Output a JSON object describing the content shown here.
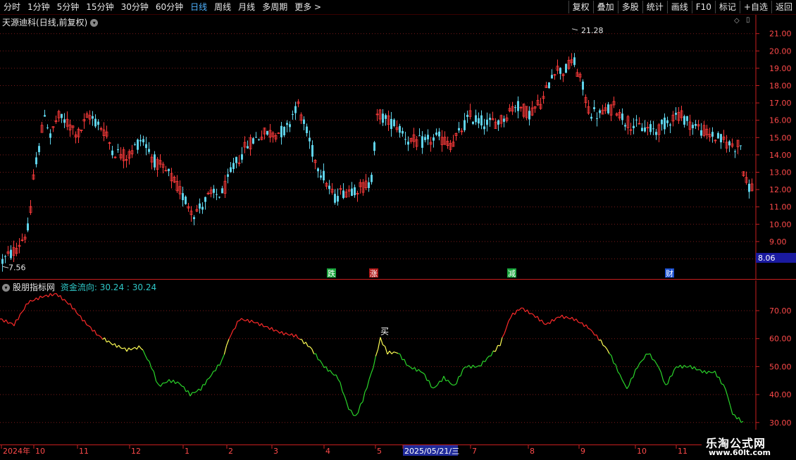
{
  "toolbar": {
    "periods": [
      "分时",
      "1分钟",
      "5分钟",
      "15分钟",
      "30分钟",
      "60分钟",
      "日线",
      "周线",
      "月线",
      "多周期",
      "更多 >"
    ],
    "active_period": "日线",
    "right_buttons": [
      "复权",
      "叠加",
      "多股",
      "统计",
      "画线",
      "F10",
      "标记",
      "+自选",
      "返回"
    ]
  },
  "main_chart": {
    "stock_name": "天源迪科",
    "mode": "(日线,前复权)",
    "price_labels": [
      "21.00",
      "20.00",
      "19.00",
      "18.00",
      "17.00",
      "16.00",
      "15.00",
      "14.00",
      "13.00",
      "12.00",
      "11.00",
      "10.00",
      "9.00",
      "8.00"
    ],
    "price_ticks": [
      21,
      20,
      19,
      18,
      17,
      16,
      15,
      14,
      13,
      12,
      11,
      10,
      9,
      8
    ],
    "high_label": "21.28",
    "low_label": "7.56",
    "current_price": "8.06",
    "markers": [
      {
        "text": "跌",
        "color": "#17a33a"
      },
      {
        "text": "涨",
        "color": "#b01818"
      },
      {
        "text": "减",
        "color": "#17a33a"
      },
      {
        "text": "财",
        "color": "#1a4fd0"
      }
    ],
    "colors": {
      "up": "#ff3b3b",
      "down": "#5fd3ea",
      "grid": "#7a1a1a",
      "axis": "#c81e1e"
    }
  },
  "indicator": {
    "name": "股朋指标网",
    "series_label": "资金流向:",
    "value1": "30.24",
    "value2": "30.24",
    "levels": [
      "70.00",
      "60.00",
      "50.00",
      "40.00",
      "30.00"
    ],
    "signal_text": "买",
    "colors": {
      "red": "#ff2a2a",
      "yellow": "#ffff55",
      "green": "#2ad52a",
      "label": "#2fc8c8"
    }
  },
  "date_axis": {
    "labels": [
      "2024年",
      "10",
      "11",
      "12",
      "1",
      "2",
      "3",
      "4",
      "5",
      "2025/05/21/三",
      "7",
      "8",
      "9",
      "10",
      "11"
    ]
  },
  "watermark": {
    "line1": "乐淘公式网",
    "line2": "www.60lt.com"
  }
}
